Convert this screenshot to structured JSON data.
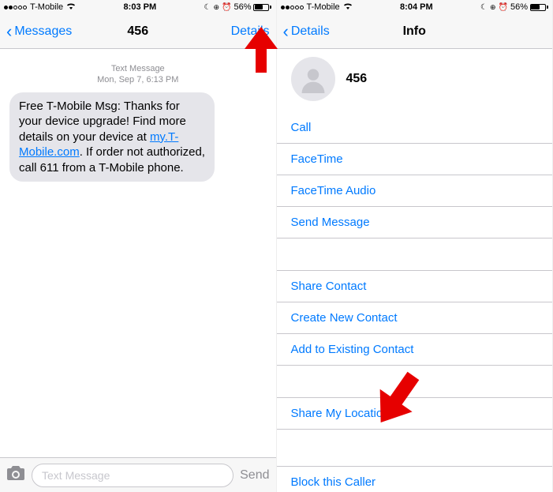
{
  "left": {
    "status": {
      "carrier": "T-Mobile",
      "time": "8:03 PM",
      "battery": "56%"
    },
    "nav": {
      "back": "Messages",
      "title": "456",
      "right": "Details"
    },
    "timestamp_label": "Text Message",
    "timestamp_date": "Mon, Sep 7,",
    "timestamp_time": "6:13 PM",
    "message_pre": "Free T-Mobile Msg: Thanks for your device upgrade! Find more details on your device at ",
    "message_link": "my.T-Mobile.com",
    "message_post": ". If order not authorized, call 611 from a T-Mobile phone.",
    "compose_placeholder": "Text Message",
    "send": "Send"
  },
  "right": {
    "status": {
      "carrier": "T-Mobile",
      "time": "8:04 PM",
      "battery": "56%"
    },
    "nav": {
      "back": "Details",
      "title": "Info"
    },
    "contact_name": "456",
    "actions1": [
      "Call",
      "FaceTime",
      "FaceTime Audio",
      "Send Message"
    ],
    "actions2": [
      "Share Contact",
      "Create New Contact",
      "Add to Existing Contact"
    ],
    "actions3": [
      "Share My Location"
    ],
    "actions4": [
      "Block this Caller"
    ]
  }
}
